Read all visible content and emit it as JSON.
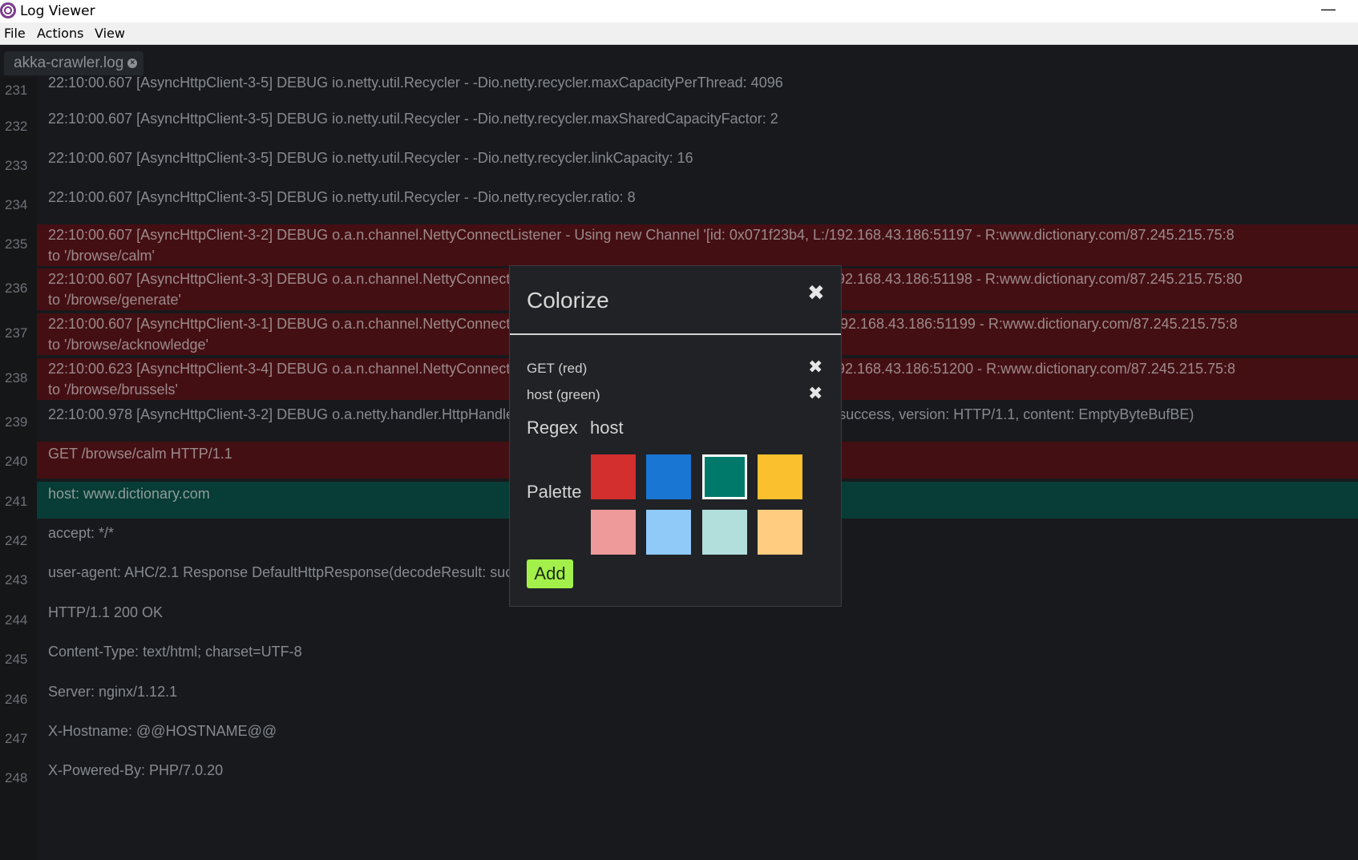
{
  "window": {
    "title": "Log Viewer",
    "minimize_glyph": "—"
  },
  "menu": {
    "items": [
      "File",
      "Actions",
      "View"
    ]
  },
  "tabs": [
    {
      "label": "akka-crawler.log"
    }
  ],
  "colors": {
    "red_row": "#440f13",
    "green_row": "#083c36",
    "add_button": "#a4f04a"
  },
  "log": {
    "lines": [
      {
        "num": "231",
        "text": "22:10:00.607 [AsyncHttpClient-3-5] DEBUG io.netty.util.Recycler - -Dio.netty.recycler.maxCapacityPerThread: 4096",
        "hl": ""
      },
      {
        "num": "232",
        "text": "22:10:00.607 [AsyncHttpClient-3-5] DEBUG io.netty.util.Recycler - -Dio.netty.recycler.maxSharedCapacityFactor: 2",
        "hl": ""
      },
      {
        "num": "233",
        "text": "22:10:00.607 [AsyncHttpClient-3-5] DEBUG io.netty.util.Recycler - -Dio.netty.recycler.linkCapacity: 16",
        "hl": ""
      },
      {
        "num": "234",
        "text": "22:10:00.607 [AsyncHttpClient-3-5] DEBUG io.netty.util.Recycler - -Dio.netty.recycler.ratio: 8",
        "hl": ""
      },
      {
        "num": "235",
        "text": "22:10:00.607 [AsyncHttpClient-3-2] DEBUG o.a.n.channel.NettyConnectListener - Using new Channel '[id: 0x071f23b4, L:/192.168.43.186:51197 - R:www.dictionary.com/87.245.215.75:8\nto '/browse/calm'",
        "hl": "red"
      },
      {
        "num": "236",
        "text": "22:10:00.607 [AsyncHttpClient-3-3] DEBUG o.a.n.channel.NettyConnectListener - Using new Channel '[id: 0x4e8f1d33, L:/192.168.43.186:51198 - R:www.dictionary.com/87.245.215.75:80\nto '/browse/generate'",
        "hl": "red"
      },
      {
        "num": "237",
        "text": "22:10:00.607 [AsyncHttpClient-3-1] DEBUG o.a.n.channel.NettyConnectListener - Using new Channel '[id: 0x9a2c5e71, L:/192.168.43.186:51199 - R:www.dictionary.com/87.245.215.75:8\nto '/browse/acknowledge'",
        "hl": "red"
      },
      {
        "num": "238",
        "text": "22:10:00.623 [AsyncHttpClient-3-4] DEBUG o.a.n.channel.NettyConnectListener - Using new Channel '[id: 0x1b7d4f02, L:/192.168.43.186:51200 - R:www.dictionary.com/87.245.215.75:8\nto '/browse/brussels'",
        "hl": "red"
      },
      {
        "num": "239",
        "text": "22:10:00.978 [AsyncHttpClient-3-2] DEBUG o.a.netty.handler.HttpHandler - Response DefaultHttpResponse(decodeResult: success, version: HTTP/1.1, content: EmptyByteBufBE)",
        "hl": ""
      },
      {
        "num": "240",
        "text": "GET /browse/calm HTTP/1.1",
        "hl": "red"
      },
      {
        "num": "241",
        "text": "host: www.dictionary.com",
        "hl": "green"
      },
      {
        "num": "242",
        "text": "accept: */*",
        "hl": ""
      },
      {
        "num": "243",
        "text": "user-agent: AHC/2.1 Response DefaultHttpResponse(decodeResult: success, version: HTTP/1.1)",
        "hl": ""
      },
      {
        "num": "244",
        "text": "HTTP/1.1 200 OK",
        "hl": ""
      },
      {
        "num": "245",
        "text": "Content-Type: text/html; charset=UTF-8",
        "hl": ""
      },
      {
        "num": "246",
        "text": "Server: nginx/1.12.1",
        "hl": ""
      },
      {
        "num": "247",
        "text": "X-Hostname: @@HOSTNAME@@",
        "hl": ""
      },
      {
        "num": "248",
        "text": "X-Powered-By: PHP/7.0.20",
        "hl": ""
      }
    ]
  },
  "colorize": {
    "title": "Colorize",
    "close_glyph": "✖",
    "rules": [
      {
        "label": "GET (red)",
        "delete_glyph": "✖"
      },
      {
        "label": "host (green)",
        "delete_glyph": "✖"
      }
    ],
    "regex_label": "Regex",
    "regex_value": "host",
    "palette_label": "Palette",
    "palette": [
      {
        "name": "red",
        "color": "#d32f2f"
      },
      {
        "name": "blue",
        "color": "#1976d2"
      },
      {
        "name": "teal",
        "color": "#00796b",
        "selected": true
      },
      {
        "name": "amber",
        "color": "#fbc02d"
      },
      {
        "name": "light-red",
        "color": "#ef9a9a"
      },
      {
        "name": "light-blue",
        "color": "#90caf9"
      },
      {
        "name": "light-teal",
        "color": "#b2dfdb"
      },
      {
        "name": "light-amber",
        "color": "#ffcc80"
      }
    ],
    "add_label": "Add"
  }
}
